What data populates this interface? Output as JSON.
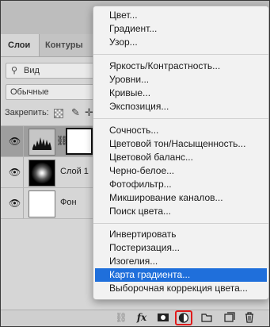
{
  "layers_panel": {
    "tabs": [
      "Слои",
      "Контуры"
    ],
    "filter_placeholder": "Вид",
    "blend_mode": "Обычные",
    "lock_label": "Закрепить:",
    "layers": [
      {
        "name": "",
        "type": "adjustment"
      },
      {
        "name": "Слой 1",
        "type": "pixel"
      },
      {
        "name": "Фон",
        "type": "background"
      }
    ]
  },
  "menu": {
    "groups": [
      [
        "Цвет...",
        "Градиент...",
        "Узор..."
      ],
      [
        "Яркость/Контрастность...",
        "Уровни...",
        "Кривые...",
        "Экспозиция..."
      ],
      [
        "Сочность...",
        "Цветовой тон/Насыщенность...",
        "Цветовой баланс...",
        "Черно-белое...",
        "Фотофильтр...",
        "Микширование каналов...",
        "Поиск цвета..."
      ],
      [
        "Инвертировать",
        "Постеризация...",
        "Изогелия...",
        "Карта градиента...",
        "Выборочная коррекция цвета..."
      ]
    ],
    "selected": "Карта градиента..."
  },
  "bottom_icons": [
    "link-icon",
    "fx-icon",
    "mask-icon",
    "adjustment-icon",
    "folder-icon",
    "new-layer-icon",
    "trash-icon"
  ],
  "bottom_fx_label": "fx",
  "colors": {
    "highlight": "#1f6fdb",
    "callout": "#e01b1b"
  }
}
